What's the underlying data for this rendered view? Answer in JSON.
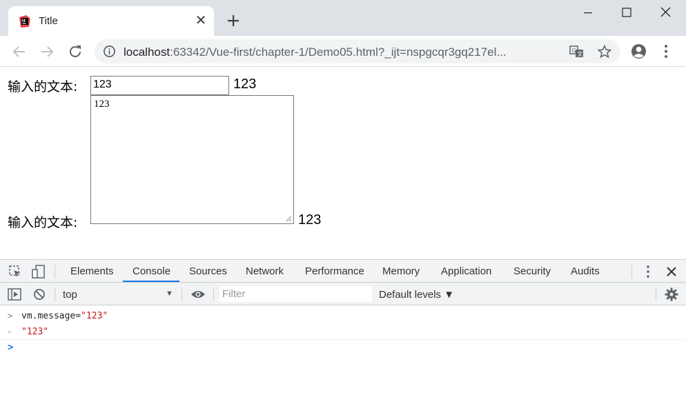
{
  "tab": {
    "title": "Title",
    "close_glyph": "✕",
    "favicon": "intellij-favicon-icon"
  },
  "toolbar": {
    "url_host": "localhost",
    "url_rest": ":63342/Vue-first/chapter-1/Demo05.html?_ijt=nspgcqr3gq217el..."
  },
  "page": {
    "label1": "输入的文本:",
    "input_value": "123",
    "echo1": "123",
    "label2": "输入的文本:",
    "textarea_value": "123",
    "echo2": "123"
  },
  "devtools": {
    "tabs": [
      "Elements",
      "Console",
      "Sources",
      "Network",
      "Performance",
      "Memory",
      "Application",
      "Security",
      "Audits"
    ],
    "active_tab": "Console",
    "context": "top",
    "filter_placeholder": "Filter",
    "levels": "Default levels ▼",
    "console": {
      "input_code": "vm.message=",
      "input_string": "\"123\"",
      "output_string": "\"123\""
    }
  },
  "colors": {
    "accent": "#1a73e8",
    "string": "#c41a16",
    "tabstrip": "#dee1e6"
  }
}
